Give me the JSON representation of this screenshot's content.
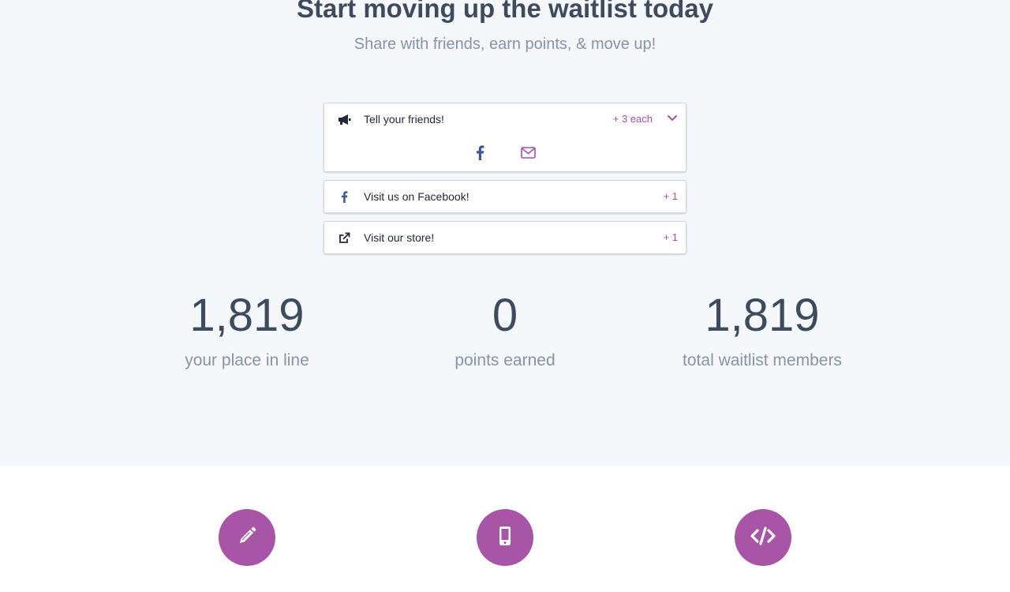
{
  "hero": {
    "title": "Start moving up the waitlist today",
    "subtitle": "Share with friends, earn points, & move up!"
  },
  "actions": [
    {
      "label": "Tell your friends!",
      "points": "+ 3 each",
      "icon": "megaphone-icon",
      "expanded": true,
      "share_options": [
        "facebook-icon",
        "envelope-icon"
      ]
    },
    {
      "label": "Visit us on Facebook!",
      "points": "+ 1",
      "icon": "facebook-icon"
    },
    {
      "label": "Visit our store!",
      "points": "+ 1",
      "icon": "external-link-icon"
    }
  ],
  "stats": [
    {
      "value": "1,819",
      "label": "your place in line"
    },
    {
      "value": "0",
      "label": "points earned"
    },
    {
      "value": "1,819",
      "label": "total waitlist members"
    }
  ],
  "features": [
    {
      "icon": "pencil-icon"
    },
    {
      "icon": "mobile-phone-icon"
    },
    {
      "icon": "code-icon"
    }
  ],
  "colors": {
    "accent": "#a855a7",
    "points": "#a64fa6",
    "facebook": "#3b5998",
    "heading": "#3e4b5e",
    "muted": "#8794a6",
    "section_bg": "#f5f8fb"
  }
}
